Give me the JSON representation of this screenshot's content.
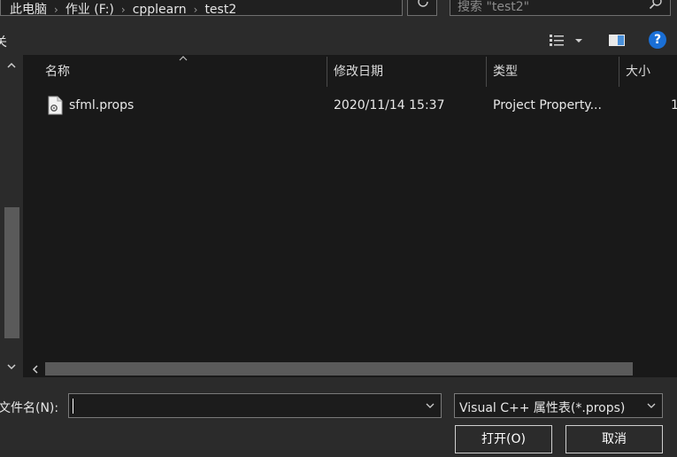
{
  "address": {
    "crumbs": [
      "此电脑",
      "作业 (F:)",
      "cpplearn",
      "test2"
    ],
    "search_placeholder": "搜索 \"test2\""
  },
  "toolbar": {
    "organize_partial": "关"
  },
  "columns": {
    "name": "名称",
    "date": "修改日期",
    "type": "类型",
    "size": "大小"
  },
  "files": [
    {
      "name": "sfml.props",
      "date": "2020/11/14 15:37",
      "type": "Project Property...",
      "size": "1"
    }
  ],
  "bottom": {
    "filename_label": "文件名(N):",
    "filename_value": "",
    "filetype_value": "Visual C++ 属性表(*.props)",
    "open_label": "打开(O)",
    "cancel_label": "取消"
  },
  "icons": {
    "help": "?",
    "colors": {
      "help_blue": "#1a6fd6",
      "list_bg": "#191919",
      "chrome_bg": "#2b2b2b"
    }
  }
}
